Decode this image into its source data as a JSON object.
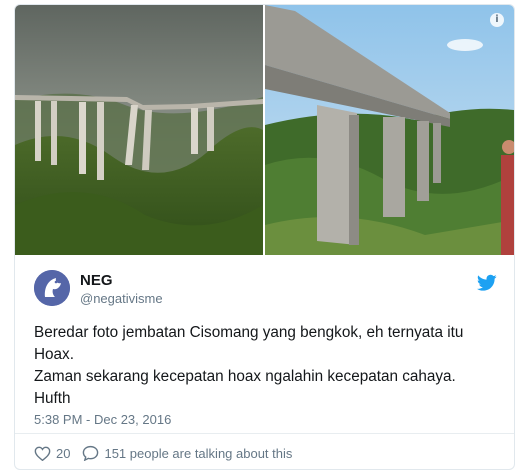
{
  "tweet": {
    "author_name": "NEG",
    "author_handle": "@negativisme",
    "text_lines": [
      "Beredar foto jembatan Cisomang yang bengkok, eh ternyata itu",
      "Hoax.",
      "Zaman sekarang kecepatan hoax ngalahin kecepatan cahaya.",
      "Hufth"
    ],
    "timestamp": "5:38 PM - Dec 23, 2016",
    "likes": "20",
    "conversation": "151 people are talking about this"
  },
  "icons": {
    "info": "info-icon",
    "brand": "twitter-bird-icon",
    "like": "heart-icon",
    "reply": "speech-bubble-icon"
  },
  "colors": {
    "brand_blue": "#1da1f2",
    "secondary_text": "#657786",
    "primary_text": "#14171a",
    "avatar_bg": "#5566a8"
  },
  "info_glyph": "i"
}
